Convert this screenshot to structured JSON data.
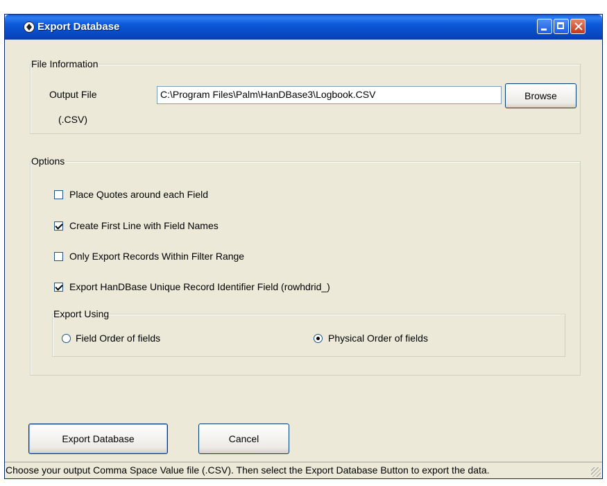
{
  "window": {
    "title": "Export Database"
  },
  "file_info": {
    "legend": "File Information",
    "output_label": "Output File",
    "ext_label": "(.CSV)",
    "path_value": "C:\\Program Files\\Palm\\HanDBase3\\Logbook.CSV",
    "browse_label": "Browse"
  },
  "options": {
    "legend": "Options",
    "checkboxes": [
      {
        "label": "Place Quotes around each Field",
        "checked": false
      },
      {
        "label": "Create First Line with Field Names",
        "checked": true
      },
      {
        "label": "Only Export Records Within Filter Range",
        "checked": false
      },
      {
        "label": "Export HanDBase Unique Record Identifier Field (rowhdrid_)",
        "checked": true
      }
    ],
    "export_using": {
      "legend": "Export Using",
      "radios": [
        {
          "label": "Field Order of fields",
          "selected": false
        },
        {
          "label": "Physical Order of fields",
          "selected": true
        }
      ]
    }
  },
  "buttons": {
    "export_label": "Export Database",
    "cancel_label": "Cancel"
  },
  "status": {
    "text": "Choose your output Comma Space Value file (.CSV).  Then select the Export Database Button to export the data."
  },
  "colors": {
    "titlebar": "#0a58d8",
    "window_bg": "#ece9d8",
    "close_button": "#c4371c"
  }
}
